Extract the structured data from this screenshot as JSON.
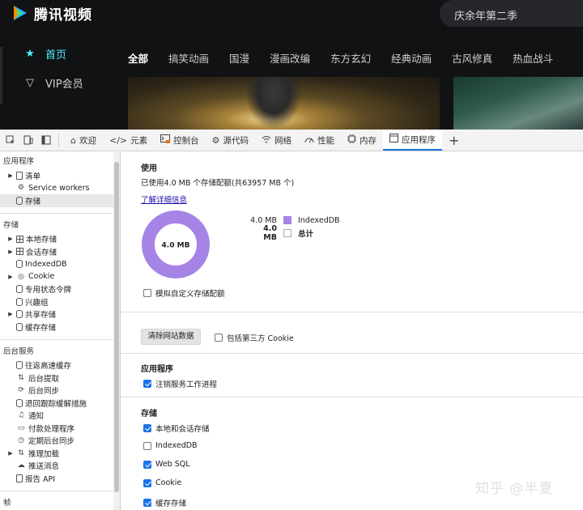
{
  "site": {
    "logo_text": "腾讯视频",
    "search_text": "庆余年第二季",
    "side_nav": [
      {
        "label": "首页",
        "icon": "star-icon",
        "active": true
      },
      {
        "label": "VIP会员",
        "icon": "vip-icon",
        "active": false
      }
    ],
    "categories": [
      "全部",
      "搞笑动画",
      "国漫",
      "漫画改编",
      "东方玄幻",
      "经典动画",
      "古风修真",
      "热血战斗"
    ]
  },
  "devtools": {
    "tabs": [
      {
        "label": "欢迎",
        "icon": "home-icon"
      },
      {
        "label": "元素",
        "icon": "code-icon"
      },
      {
        "label": "控制台",
        "icon": "console-icon"
      },
      {
        "label": "源代码",
        "icon": "bug-icon"
      },
      {
        "label": "网络",
        "icon": "wifi-icon"
      },
      {
        "label": "性能",
        "icon": "performance-icon"
      },
      {
        "label": "内存",
        "icon": "memory-icon"
      },
      {
        "label": "应用程序",
        "icon": "application-icon",
        "active": true
      }
    ],
    "tree": {
      "app_title": "应用程序",
      "app_items": [
        "清单",
        "Service workers",
        "存储"
      ],
      "storage_title": "存储",
      "storage_items": [
        "本地存储",
        "会话存储",
        "IndexedDB",
        "Cookie",
        "专用状态令牌",
        "兴趣组",
        "共享存储",
        "缓存存储"
      ],
      "bg_title": "后台服务",
      "bg_items": [
        "往返高速缓存",
        "后台提取",
        "后台同步",
        "退回跟踪缓解措施",
        "通知",
        "付款处理程序",
        "定期后台同步",
        "推理加载",
        "推送消息",
        "报告 API"
      ],
      "frames_title": "帧"
    },
    "usage": {
      "heading": "使用",
      "text": "已使用4.0 MB 个存储配额(共63957 MB 个)",
      "learn_more": "了解详细信息",
      "donut_label": "4.0 MB",
      "legend": [
        {
          "size": "4.0 MB",
          "name": "IndexedDB",
          "color": "#a584e6"
        },
        {
          "size": "4.0 MB",
          "name": "总计",
          "color": "#ffffff"
        }
      ],
      "custom_quota": "模拟自定义存储配额"
    },
    "clear": {
      "button": "清除网站数据",
      "third_party": "包括第三方 Cookie"
    },
    "application_section": {
      "heading": "应用程序",
      "unregister": "注销服务工作进程"
    },
    "storage_section": {
      "heading": "存储",
      "options": [
        {
          "label": "本地和会话存储",
          "checked": true
        },
        {
          "label": "IndexedDB",
          "checked": false
        },
        {
          "label": "Web SQL",
          "checked": true
        },
        {
          "label": "Cookie",
          "checked": true
        },
        {
          "label": "缓存存储",
          "checked": true
        }
      ]
    }
  },
  "watermark": "知乎 @半夏"
}
